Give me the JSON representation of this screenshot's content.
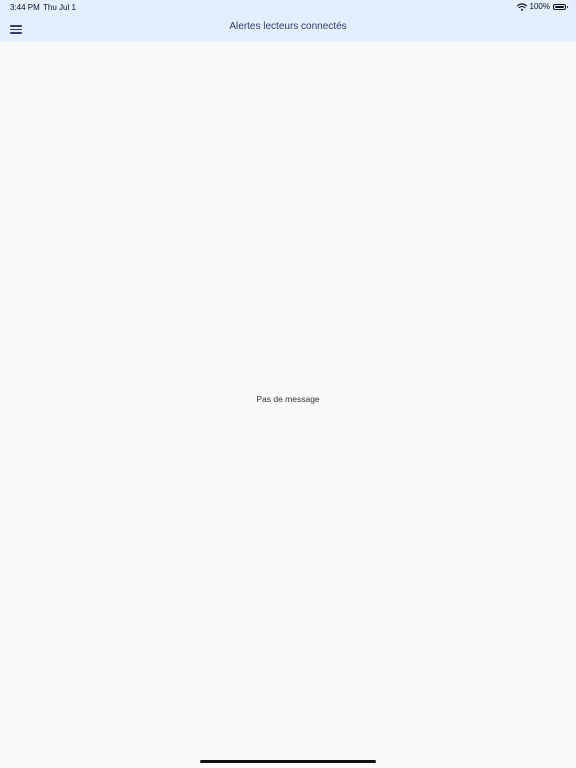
{
  "status_bar": {
    "time": "3:44 PM",
    "date": "Thu Jul 1",
    "battery_percent": "100%",
    "battery_level": 1.0,
    "wifi_icon": "wifi-icon",
    "battery_icon": "battery-icon"
  },
  "header": {
    "title": "Alertes lecteurs connectés",
    "menu_icon": "hamburger-menu-icon",
    "background_color": "#e3efff",
    "title_color": "#2c3e6e"
  },
  "main": {
    "empty_message": "Pas de message",
    "background_color": "#fafafa"
  }
}
